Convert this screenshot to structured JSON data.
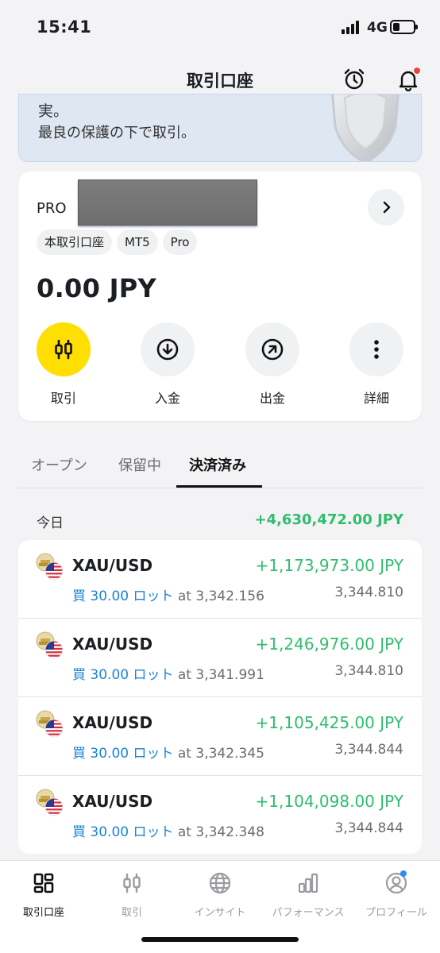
{
  "status_bar": {
    "time": "15:41",
    "network": "4G",
    "battery_level": 0.35
  },
  "header": {
    "title": "取引口座",
    "alarm_icon": "alarm-clock-icon",
    "bell_icon": "bell-icon"
  },
  "banner": {
    "line1": "実。",
    "line2": "最良の保護の下で取引。"
  },
  "account": {
    "type": "PRO",
    "tags": [
      "本取引口座",
      "MT5",
      "Pro"
    ],
    "balance": "0.00 JPY",
    "actions": [
      {
        "label": "取引",
        "icon": "trade-icon"
      },
      {
        "label": "入金",
        "icon": "deposit-icon"
      },
      {
        "label": "出金",
        "icon": "withdraw-icon"
      },
      {
        "label": "詳細",
        "icon": "more-icon"
      }
    ]
  },
  "tabs": [
    "オープン",
    "保留中",
    "決済済み"
  ],
  "active_tab": "決済済み",
  "today": {
    "label": "今日",
    "total": "+4,630,472.00 JPY"
  },
  "trades": [
    {
      "symbol": "XAU/USD",
      "pnl": "+1,173,973.00 JPY",
      "side": "買",
      "lots": "30.00 ロット",
      "open_price": "at 3,342.156",
      "close_price": "3,344.810"
    },
    {
      "symbol": "XAU/USD",
      "pnl": "+1,246,976.00 JPY",
      "side": "買",
      "lots": "30.00 ロット",
      "open_price": "at 3,341.991",
      "close_price": "3,344.810"
    },
    {
      "symbol": "XAU/USD",
      "pnl": "+1,105,425.00 JPY",
      "side": "買",
      "lots": "30.00 ロット",
      "open_price": "at 3,342.345",
      "close_price": "3,344.844"
    },
    {
      "symbol": "XAU/USD",
      "pnl": "+1,104,098.00 JPY",
      "side": "買",
      "lots": "30.00 ロット",
      "open_price": "at 3,342.348",
      "close_price": "3,344.844"
    }
  ],
  "bottom_nav": [
    {
      "label": "取引口座",
      "icon": "accounts-icon",
      "active": true
    },
    {
      "label": "取引",
      "icon": "trade-icon",
      "active": false
    },
    {
      "label": "インサイト",
      "icon": "globe-icon",
      "active": false
    },
    {
      "label": "パフォーマンス",
      "icon": "bar-chart-icon",
      "active": false
    },
    {
      "label": "プロフィール",
      "icon": "profile-icon",
      "active": false
    }
  ],
  "colors": {
    "profit": "#2fbe6c",
    "accent_yellow": "#ffde02",
    "link_blue": "#1a84d6",
    "notification_red": "#ea4437"
  }
}
